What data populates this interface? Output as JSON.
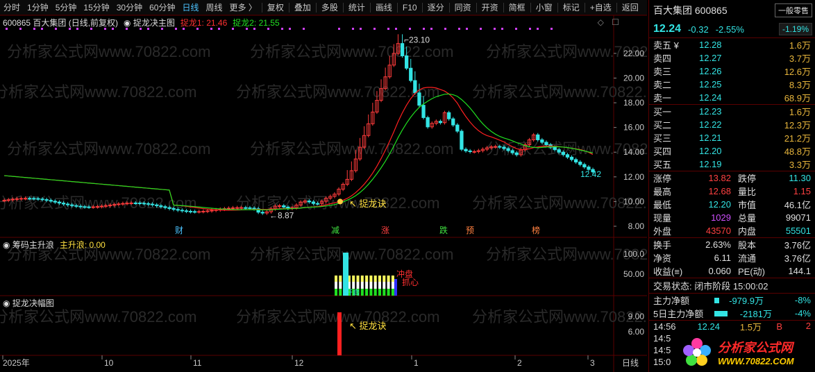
{
  "toolbar": {
    "left_items": [
      "分时",
      "1分钟",
      "5分钟",
      "15分钟",
      "30分钟",
      "60分钟",
      "日线",
      "周线",
      "更多 〉"
    ],
    "active_item": "日线",
    "right_items": [
      "复权",
      "叠加",
      "多股",
      "统计",
      "画线",
      "F10",
      "逐分",
      "同资",
      "开资",
      "简框",
      "小窗",
      "标记",
      "+自选",
      "返回"
    ]
  },
  "main_chart": {
    "stock_label": "600865 百大集团 (日线,前复权)",
    "indicator_name": "捉龙决主图",
    "line1_label": "捉龙1: 21.46",
    "line2_label": "捉龙2: 21.55",
    "price_axis": [
      "22.00",
      "20.00",
      "18.00",
      "16.00",
      "14.00",
      "12.00",
      "10.00",
      "8.00"
    ],
    "high_label": "23.10",
    "low_label": "8.87",
    "last_label": "12.42",
    "signal_label": "捉龙诀",
    "event_marks": [
      "财",
      "减",
      "涨",
      "跌",
      "预",
      "榜"
    ],
    "watermark": "分析家公式网www.70822.com"
  },
  "sub1": {
    "name": "筹码主升浪",
    "value_label": "主升浪: 0.00",
    "axis": [
      "100.0",
      "50.00"
    ],
    "annot1": "冲盘",
    "annot2": "抓心",
    "annot3": "开启"
  },
  "sub2": {
    "name": "捉龙决幅图",
    "axis": [
      "9.00",
      "6.00"
    ],
    "signal_label": "捉龙诀"
  },
  "time_axis": [
    "2025年",
    "10",
    "11",
    "12",
    "1",
    "2",
    "3"
  ],
  "time_mode": "日线",
  "colors": {
    "up": "#ff3b3b",
    "down": "#33e4e4",
    "line1": "#ff2020",
    "line2": "#20e020",
    "accent": "#e8b63c"
  },
  "quote": {
    "name": "百大集团 600865",
    "button": "一般零售",
    "price": "12.24",
    "change": "-0.32",
    "change_pct": "-2.55%",
    "other_pct": "-1.19%"
  },
  "asks": [
    {
      "label": "卖五 ¥",
      "price": "12.28",
      "vol": "1.6万"
    },
    {
      "label": "卖四",
      "price": "12.27",
      "vol": "3.7万"
    },
    {
      "label": "卖三",
      "price": "12.26",
      "vol": "12.6万"
    },
    {
      "label": "卖二",
      "price": "12.25",
      "vol": "8.3万"
    },
    {
      "label": "卖一",
      "price": "12.24",
      "vol": "68.9万"
    }
  ],
  "bids": [
    {
      "label": "买一",
      "price": "12.23",
      "vol": "1.6万"
    },
    {
      "label": "买二",
      "price": "12.22",
      "vol": "12.3万"
    },
    {
      "label": "买三",
      "price": "12.21",
      "vol": "21.2万"
    },
    {
      "label": "买四",
      "price": "12.20",
      "vol": "48.8万"
    },
    {
      "label": "买五",
      "price": "12.19",
      "vol": "3.3万"
    }
  ],
  "stats1": [
    {
      "a": "涨停",
      "b": "13.82",
      "bc": "red",
      "c": "跌停",
      "d": "11.30",
      "dc": "cyan"
    },
    {
      "a": "最高",
      "b": "12.68",
      "bc": "red",
      "c": "量比",
      "d": "1.15",
      "dc": "red"
    },
    {
      "a": "最低",
      "b": "12.20",
      "bc": "cyan",
      "c": "市值",
      "d": "46.1亿",
      "dc": "wht"
    },
    {
      "a": "现量",
      "b": "1029",
      "bc": "purple",
      "c": "总量",
      "d": "99071",
      "dc": "wht"
    },
    {
      "a": "外盘",
      "b": "43570",
      "bc": "red",
      "c": "内盘",
      "d": "55501",
      "dc": "cyan"
    }
  ],
  "stats2": [
    {
      "a": "换手",
      "b": "2.63%",
      "bc": "wht",
      "c": "股本",
      "d": "3.76亿",
      "dc": "wht"
    },
    {
      "a": "净资",
      "b": "6.11",
      "bc": "wht",
      "c": "流通",
      "d": "3.76亿",
      "dc": "wht"
    },
    {
      "a": "收益(≡)",
      "b": "0.060",
      "bc": "wht",
      "c": "PE(动)",
      "d": "144.1",
      "dc": "wht"
    }
  ],
  "trade_state": "交易状态: 闭市阶段 15:00:02",
  "flows": [
    {
      "label": "主力净额",
      "value": "-979.9万",
      "pct": "-8%",
      "bar": 0.12
    },
    {
      "label": "5日主力净额",
      "value": "-2181万",
      "pct": "-4%",
      "bar": 0.32
    }
  ],
  "ticks": [
    {
      "t": "14:56",
      "p": "12.24",
      "v": "1.5万",
      "bs": "B"
    },
    {
      "t": "14:5",
      "p": "",
      "v": "",
      "bs": ""
    },
    {
      "t": "14:5",
      "p": "",
      "v": "",
      "bs": ""
    },
    {
      "t": "15:0",
      "p": "",
      "v": "",
      "bs": ""
    }
  ],
  "tick_last_num": "2",
  "logo": {
    "line1": "分析家公式网",
    "line2": "WWW.70822.COM"
  }
}
